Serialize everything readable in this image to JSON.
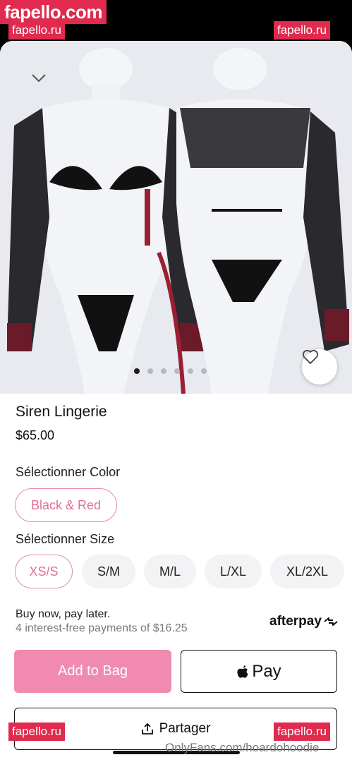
{
  "watermarks": {
    "top_banner": "fapello.com",
    "corner_tag": "fapello.ru",
    "bottom_text": "OnlyFans.com/hoardohoodie"
  },
  "gallery": {
    "image_alt": "Siren Lingerie product photo",
    "dots_total": 6,
    "active_dot": 0
  },
  "product": {
    "title": "Siren Lingerie",
    "price": "$65.00"
  },
  "color": {
    "label": "Sélectionner Color",
    "options": [
      "Black & Red"
    ],
    "selected": "Black & Red"
  },
  "size": {
    "label": "Sélectionner Size",
    "options": [
      "XS/S",
      "S/M",
      "M/L",
      "L/XL",
      "XL/2XL"
    ],
    "selected": "XS/S"
  },
  "bnpl": {
    "line1": "Buy now, pay later.",
    "line2": "4 interest-free payments of $16.25",
    "brand": "afterpay"
  },
  "actions": {
    "add_to_bag": "Add to Bag",
    "apple_pay": "Pay",
    "share": "Partager"
  },
  "colors": {
    "accent_pink": "#f08ab0",
    "chip_selected_border": "#e58aaa",
    "watermark_red": "#e02a4e"
  }
}
